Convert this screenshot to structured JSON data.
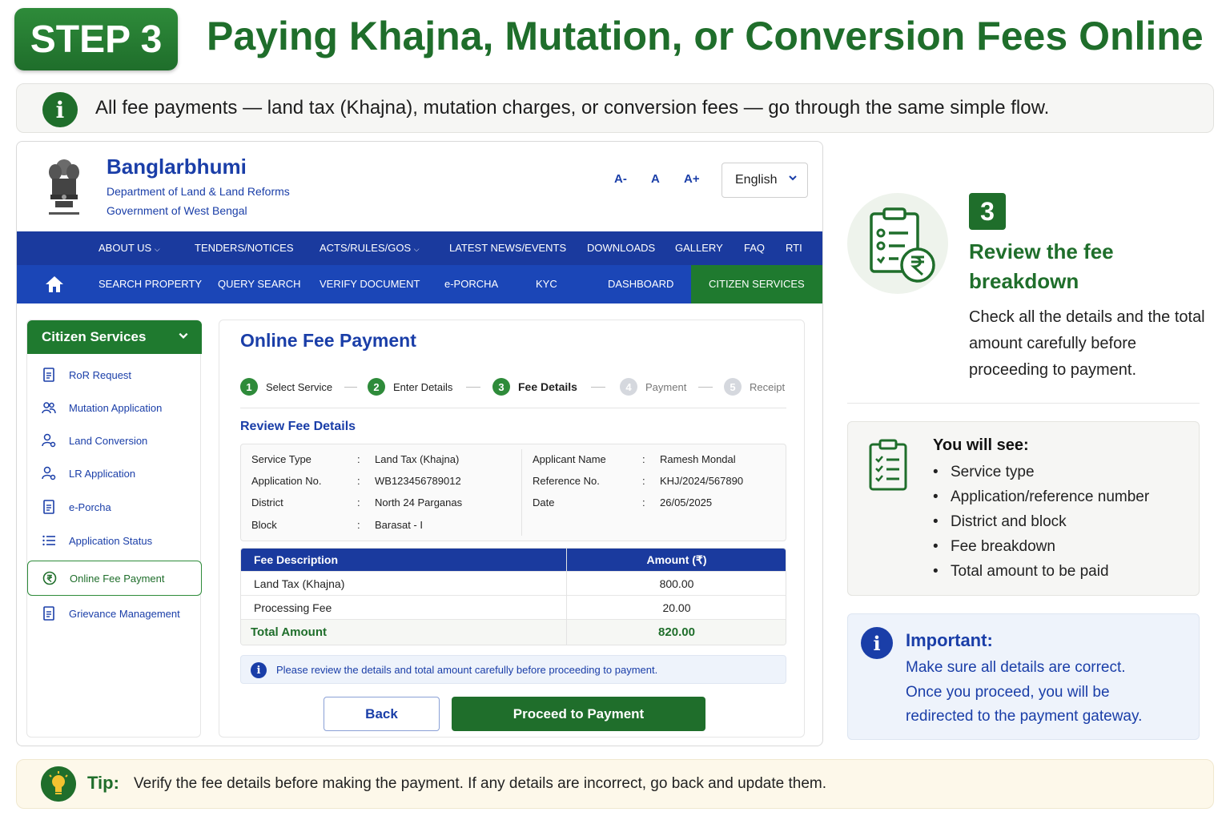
{
  "header": {
    "step_label": "STEP 3",
    "title": "Paying Khajna, Mutation, or Conversion Fees Online"
  },
  "info_bar": {
    "icon": "info-icon",
    "text": "All fee payments — land tax (Khajna), mutation charges, or conversion fees — go through the same simple flow."
  },
  "portal": {
    "site_name": "Banglarbhumi",
    "department": "Department of Land & Land Reforms",
    "government": "Government of West Bengal",
    "font_sizes": [
      "A-",
      "A",
      "A+"
    ],
    "language": "English",
    "nav_primary": [
      "ABOUT US",
      "TENDERS/NOTICES",
      "ACTS/RULES/GOS",
      "LATEST NEWS/EVENTS",
      "DOWNLOADS",
      "GALLERY",
      "FAQ",
      "RTI"
    ],
    "nav_secondary": [
      "SEARCH PROPERTY",
      "QUERY SEARCH",
      "VERIFY DOCUMENT",
      "e-PORCHA",
      "KYC",
      "DASHBOARD",
      "CITIZEN SERVICES"
    ],
    "sidebar": {
      "title": "Citizen Services",
      "items": [
        {
          "label": "RoR Request",
          "icon": "document-icon"
        },
        {
          "label": "Mutation Application",
          "icon": "users-icon"
        },
        {
          "label": "Land Conversion",
          "icon": "user-gear-icon"
        },
        {
          "label": "LR Application",
          "icon": "user-gear-icon"
        },
        {
          "label": "e-Porcha",
          "icon": "document-icon"
        },
        {
          "label": "Application Status",
          "icon": "list-icon"
        },
        {
          "label": "Online Fee Payment",
          "icon": "rupee-icon"
        },
        {
          "label": "Grievance Management",
          "icon": "document-icon"
        }
      ]
    },
    "content": {
      "title": "Online Fee Payment",
      "steps": [
        {
          "num": "1",
          "label": "Select Service"
        },
        {
          "num": "2",
          "label": "Enter Details"
        },
        {
          "num": "3",
          "label": "Fee Details"
        },
        {
          "num": "4",
          "label": "Payment"
        },
        {
          "num": "5",
          "label": "Receipt"
        }
      ],
      "review_title": "Review Fee Details",
      "details_left": [
        {
          "label": "Service Type",
          "value": "Land Tax (Khajna)"
        },
        {
          "label": "Application No.",
          "value": "WB123456789012"
        },
        {
          "label": "District",
          "value": "North 24 Parganas"
        },
        {
          "label": "Block",
          "value": "Barasat - I"
        }
      ],
      "details_right": [
        {
          "label": "Applicant Name",
          "value": "Ramesh Mondal"
        },
        {
          "label": "Reference No.",
          "value": "KHJ/2024/567890"
        },
        {
          "label": "Date",
          "value": "26/05/2025"
        }
      ],
      "colon": ":",
      "fee_table": {
        "headers": [
          "Fee Description",
          "Amount (₹)"
        ],
        "rows": [
          {
            "desc": "Land Tax (Khajna)",
            "amount": "800.00"
          },
          {
            "desc": "Processing Fee",
            "amount": "20.00"
          }
        ],
        "total": {
          "desc": "Total Amount",
          "amount": "820.00"
        }
      },
      "notice": "Please review the details and total amount carefully before proceeding to payment.",
      "back_label": "Back",
      "proceed_label": "Proceed to Payment"
    }
  },
  "side_panel": {
    "step_number": "3",
    "heading": "Review the fee breakdown",
    "description": "Check all the details and the total amount carefully before proceeding to payment.",
    "see_title": "You will see:",
    "see_items": [
      "Service type",
      "Application/reference number",
      "District and block",
      "Fee breakdown",
      "Total amount to be paid"
    ],
    "important_title": "Important:",
    "important_lines": [
      "Make sure all details are correct.",
      "Once you proceed, you will be",
      "redirected to the payment gateway."
    ]
  },
  "tip": {
    "label": "Tip:",
    "text": "Verify the fee details before making the payment. If any details are incorrect, go back and update them."
  },
  "colors": {
    "primary_green": "#1f6e2b",
    "primary_blue": "#1a3ea8",
    "nav_blue": "#1a3a9e"
  }
}
